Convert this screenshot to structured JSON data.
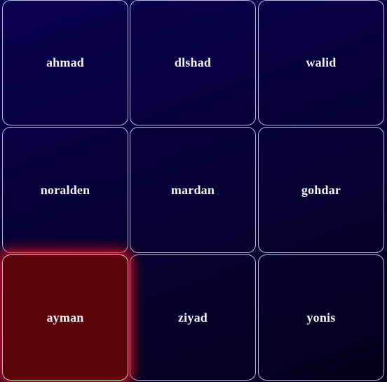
{
  "tiles": [
    {
      "label": "ahmad"
    },
    {
      "label": "dlshad"
    },
    {
      "label": "walid"
    },
    {
      "label": "noralden"
    },
    {
      "label": "mardan"
    },
    {
      "label": "gohdar"
    },
    {
      "label": "ayman",
      "selected": true
    },
    {
      "label": "ziyad"
    },
    {
      "label": "yonis"
    }
  ],
  "colors": {
    "background_top": "#0a0050",
    "background_bottom": "#02001a",
    "selected_tile": "#5a040a",
    "selected_glow": "#ff1414",
    "tile_border": "#dcdcff",
    "label_text": "#f2f2f7"
  }
}
